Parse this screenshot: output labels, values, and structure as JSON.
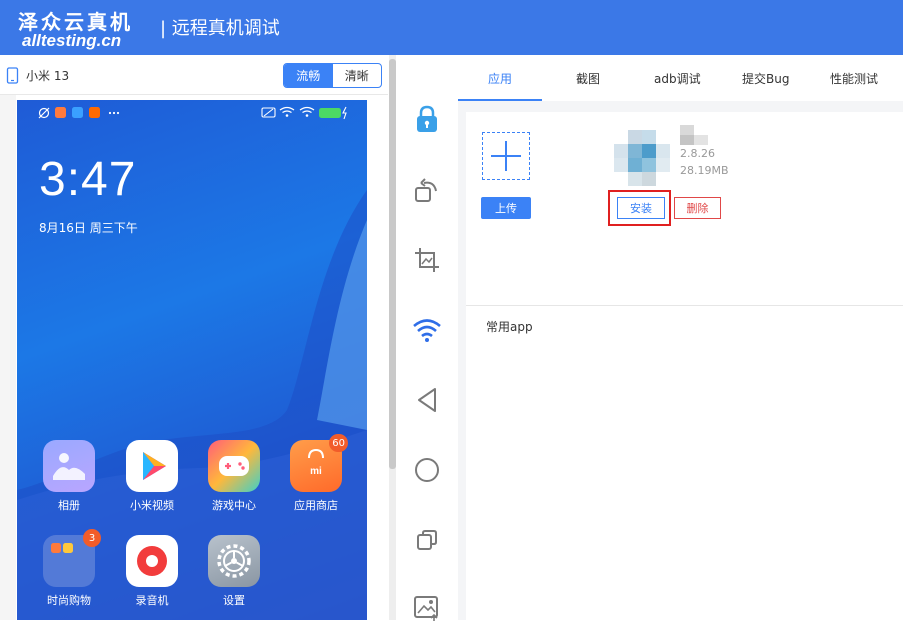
{
  "header": {
    "logo_cn": "泽众云真机",
    "logo_en": "alltesting.cn",
    "title": "| 远程真机调试"
  },
  "device": {
    "name": "小米 13",
    "quality_options": [
      "流畅",
      "清晰"
    ],
    "quality_selected": "流畅"
  },
  "phone": {
    "time": "3:47",
    "date": "8月16日 周三下午",
    "battery": "100",
    "apps_row1": [
      {
        "label": "相册",
        "icon": "gallery-icon"
      },
      {
        "label": "小米视频",
        "icon": "video-icon"
      },
      {
        "label": "游戏中心",
        "icon": "game-icon"
      },
      {
        "label": "应用商店",
        "icon": "store-icon",
        "badge": "60"
      }
    ],
    "apps_row2": [
      {
        "label": "时尚购物",
        "icon": "folder-icon",
        "badge": "3"
      },
      {
        "label": "录音机",
        "icon": "recorder-icon"
      },
      {
        "label": "设置",
        "icon": "settings-icon"
      }
    ]
  },
  "tools": [
    "lock-icon",
    "rotate-icon",
    "crop-icon",
    "wifi-icon",
    "back-icon",
    "home-icon",
    "recent-icon",
    "image-upload-icon"
  ],
  "tabs": [
    "应用",
    "截图",
    "adb调试",
    "提交Bug",
    "性能测试"
  ],
  "active_tab": "应用",
  "app_panel": {
    "upload_label": "上传",
    "app_version": "2.8.26",
    "app_size": "28.19MB",
    "install_label": "安装",
    "delete_label": "删除",
    "common_apps_label": "常用app"
  },
  "colors": {
    "header_bg": "#3b78e7",
    "accent": "#3b82f6",
    "highlight": "#e02020",
    "delete": "#e04848"
  }
}
